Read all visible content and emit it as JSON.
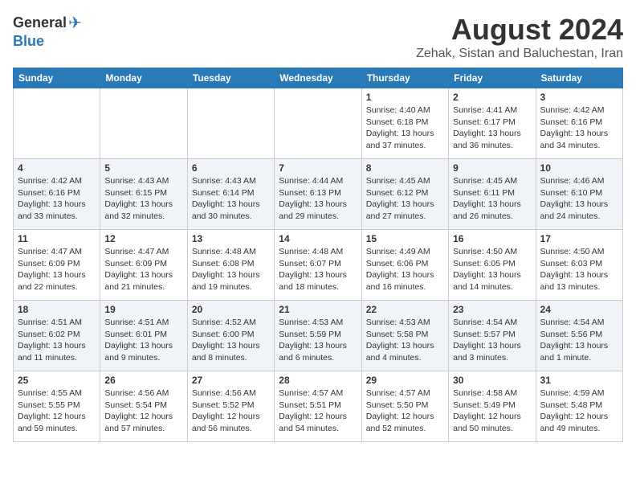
{
  "header": {
    "logo_line1": "General",
    "logo_line2": "Blue",
    "month_title": "August 2024",
    "location": "Zehak, Sistan and Baluchestan, Iran"
  },
  "days_of_week": [
    "Sunday",
    "Monday",
    "Tuesday",
    "Wednesday",
    "Thursday",
    "Friday",
    "Saturday"
  ],
  "weeks": [
    {
      "days": [
        {
          "num": "",
          "info": ""
        },
        {
          "num": "",
          "info": ""
        },
        {
          "num": "",
          "info": ""
        },
        {
          "num": "",
          "info": ""
        },
        {
          "num": "1",
          "info": "Sunrise: 4:40 AM\nSunset: 6:18 PM\nDaylight: 13 hours\nand 37 minutes."
        },
        {
          "num": "2",
          "info": "Sunrise: 4:41 AM\nSunset: 6:17 PM\nDaylight: 13 hours\nand 36 minutes."
        },
        {
          "num": "3",
          "info": "Sunrise: 4:42 AM\nSunset: 6:16 PM\nDaylight: 13 hours\nand 34 minutes."
        }
      ]
    },
    {
      "days": [
        {
          "num": "4",
          "info": "Sunrise: 4:42 AM\nSunset: 6:16 PM\nDaylight: 13 hours\nand 33 minutes."
        },
        {
          "num": "5",
          "info": "Sunrise: 4:43 AM\nSunset: 6:15 PM\nDaylight: 13 hours\nand 32 minutes."
        },
        {
          "num": "6",
          "info": "Sunrise: 4:43 AM\nSunset: 6:14 PM\nDaylight: 13 hours\nand 30 minutes."
        },
        {
          "num": "7",
          "info": "Sunrise: 4:44 AM\nSunset: 6:13 PM\nDaylight: 13 hours\nand 29 minutes."
        },
        {
          "num": "8",
          "info": "Sunrise: 4:45 AM\nSunset: 6:12 PM\nDaylight: 13 hours\nand 27 minutes."
        },
        {
          "num": "9",
          "info": "Sunrise: 4:45 AM\nSunset: 6:11 PM\nDaylight: 13 hours\nand 26 minutes."
        },
        {
          "num": "10",
          "info": "Sunrise: 4:46 AM\nSunset: 6:10 PM\nDaylight: 13 hours\nand 24 minutes."
        }
      ]
    },
    {
      "days": [
        {
          "num": "11",
          "info": "Sunrise: 4:47 AM\nSunset: 6:09 PM\nDaylight: 13 hours\nand 22 minutes."
        },
        {
          "num": "12",
          "info": "Sunrise: 4:47 AM\nSunset: 6:09 PM\nDaylight: 13 hours\nand 21 minutes."
        },
        {
          "num": "13",
          "info": "Sunrise: 4:48 AM\nSunset: 6:08 PM\nDaylight: 13 hours\nand 19 minutes."
        },
        {
          "num": "14",
          "info": "Sunrise: 4:48 AM\nSunset: 6:07 PM\nDaylight: 13 hours\nand 18 minutes."
        },
        {
          "num": "15",
          "info": "Sunrise: 4:49 AM\nSunset: 6:06 PM\nDaylight: 13 hours\nand 16 minutes."
        },
        {
          "num": "16",
          "info": "Sunrise: 4:50 AM\nSunset: 6:05 PM\nDaylight: 13 hours\nand 14 minutes."
        },
        {
          "num": "17",
          "info": "Sunrise: 4:50 AM\nSunset: 6:03 PM\nDaylight: 13 hours\nand 13 minutes."
        }
      ]
    },
    {
      "days": [
        {
          "num": "18",
          "info": "Sunrise: 4:51 AM\nSunset: 6:02 PM\nDaylight: 13 hours\nand 11 minutes."
        },
        {
          "num": "19",
          "info": "Sunrise: 4:51 AM\nSunset: 6:01 PM\nDaylight: 13 hours\nand 9 minutes."
        },
        {
          "num": "20",
          "info": "Sunrise: 4:52 AM\nSunset: 6:00 PM\nDaylight: 13 hours\nand 8 minutes."
        },
        {
          "num": "21",
          "info": "Sunrise: 4:53 AM\nSunset: 5:59 PM\nDaylight: 13 hours\nand 6 minutes."
        },
        {
          "num": "22",
          "info": "Sunrise: 4:53 AM\nSunset: 5:58 PM\nDaylight: 13 hours\nand 4 minutes."
        },
        {
          "num": "23",
          "info": "Sunrise: 4:54 AM\nSunset: 5:57 PM\nDaylight: 13 hours\nand 3 minutes."
        },
        {
          "num": "24",
          "info": "Sunrise: 4:54 AM\nSunset: 5:56 PM\nDaylight: 13 hours\nand 1 minute."
        }
      ]
    },
    {
      "days": [
        {
          "num": "25",
          "info": "Sunrise: 4:55 AM\nSunset: 5:55 PM\nDaylight: 12 hours\nand 59 minutes."
        },
        {
          "num": "26",
          "info": "Sunrise: 4:56 AM\nSunset: 5:54 PM\nDaylight: 12 hours\nand 57 minutes."
        },
        {
          "num": "27",
          "info": "Sunrise: 4:56 AM\nSunset: 5:52 PM\nDaylight: 12 hours\nand 56 minutes."
        },
        {
          "num": "28",
          "info": "Sunrise: 4:57 AM\nSunset: 5:51 PM\nDaylight: 12 hours\nand 54 minutes."
        },
        {
          "num": "29",
          "info": "Sunrise: 4:57 AM\nSunset: 5:50 PM\nDaylight: 12 hours\nand 52 minutes."
        },
        {
          "num": "30",
          "info": "Sunrise: 4:58 AM\nSunset: 5:49 PM\nDaylight: 12 hours\nand 50 minutes."
        },
        {
          "num": "31",
          "info": "Sunrise: 4:59 AM\nSunset: 5:48 PM\nDaylight: 12 hours\nand 49 minutes."
        }
      ]
    }
  ]
}
